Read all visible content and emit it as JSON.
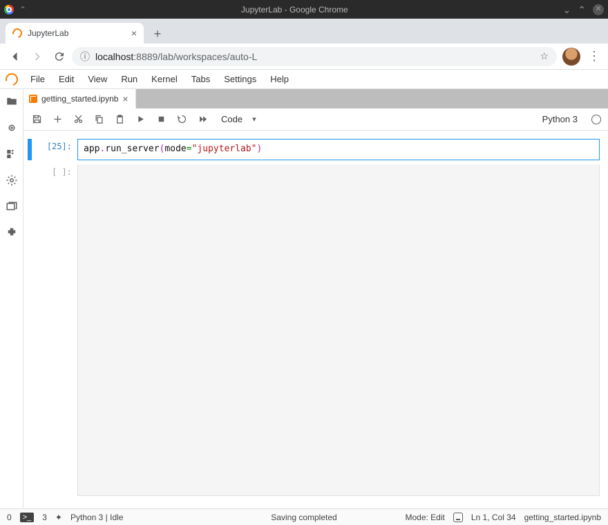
{
  "os": {
    "title": "JupyterLab - Google Chrome"
  },
  "browser": {
    "tab_title": "JupyterLab",
    "url_host": "localhost",
    "url_rest": ":8889/lab/workspaces/auto-L"
  },
  "menubar": [
    "File",
    "Edit",
    "View",
    "Run",
    "Kernel",
    "Tabs",
    "Settings",
    "Help"
  ],
  "sidebar_icons": [
    "folder-icon",
    "running-icon",
    "commands-icon",
    "settings-icon",
    "tabs-icon",
    "extension-icon"
  ],
  "doc_tab": {
    "title": "getting_started.ipynb"
  },
  "toolbar": {
    "celltype": "Code",
    "kernel_name": "Python 3"
  },
  "cells": [
    {
      "exec_count": "[25]:",
      "code_tokens": [
        {
          "t": "app",
          "c": "id"
        },
        {
          "t": ".",
          "c": "op"
        },
        {
          "t": "run_server",
          "c": "fn"
        },
        {
          "t": "(",
          "c": "op"
        },
        {
          "t": "mode",
          "c": "id"
        },
        {
          "t": "=",
          "c": "kw"
        },
        {
          "t": "\"jupyterlab\"",
          "c": "str"
        },
        {
          "t": ")",
          "c": "op"
        }
      ]
    },
    {
      "exec_count": "[ ]:"
    }
  ],
  "statusbar": {
    "left_num": "0",
    "term_count": "3",
    "puzzle": "✦",
    "kernel": "Python 3 | Idle",
    "center": "Saving completed",
    "mode": "Mode: Edit",
    "cursor": "Ln 1, Col 34",
    "file": "getting_started.ipynb"
  }
}
